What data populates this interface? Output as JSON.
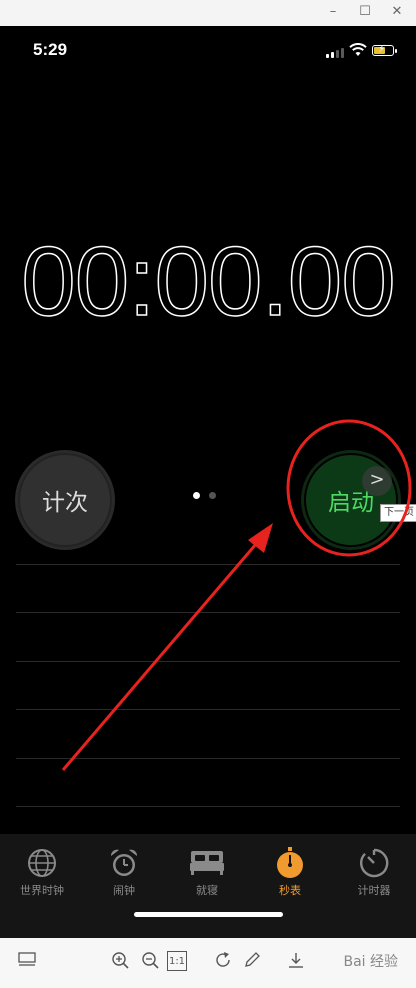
{
  "viewer": {
    "window_controls": [
      "–",
      "☐",
      "✕"
    ],
    "zoom_ratio_label": "1:1",
    "watermark": "Bai 经验"
  },
  "status_bar": {
    "time": "5:29",
    "signal_bars": 2,
    "battery_charging": true
  },
  "stopwatch": {
    "display": "00:00.00",
    "lap_button": "计次",
    "start_button": "启动",
    "page_dots": 2,
    "active_page": 0
  },
  "overlay": {
    "next_tooltip": "下一页",
    "next_arrow": ">"
  },
  "tabbar": {
    "tabs": [
      {
        "label": "世界时钟",
        "icon": "globe-icon"
      },
      {
        "label": "闹钟",
        "icon": "alarm-clock-icon"
      },
      {
        "label": "就寝",
        "icon": "bed-icon"
      },
      {
        "label": "秒表",
        "icon": "stopwatch-icon"
      },
      {
        "label": "计时器",
        "icon": "timer-icon"
      }
    ],
    "active_index": 3
  },
  "colors": {
    "accent_orange": "#f19a2f",
    "start_green": "#4cd964",
    "annotation_red": "#e8231f"
  }
}
